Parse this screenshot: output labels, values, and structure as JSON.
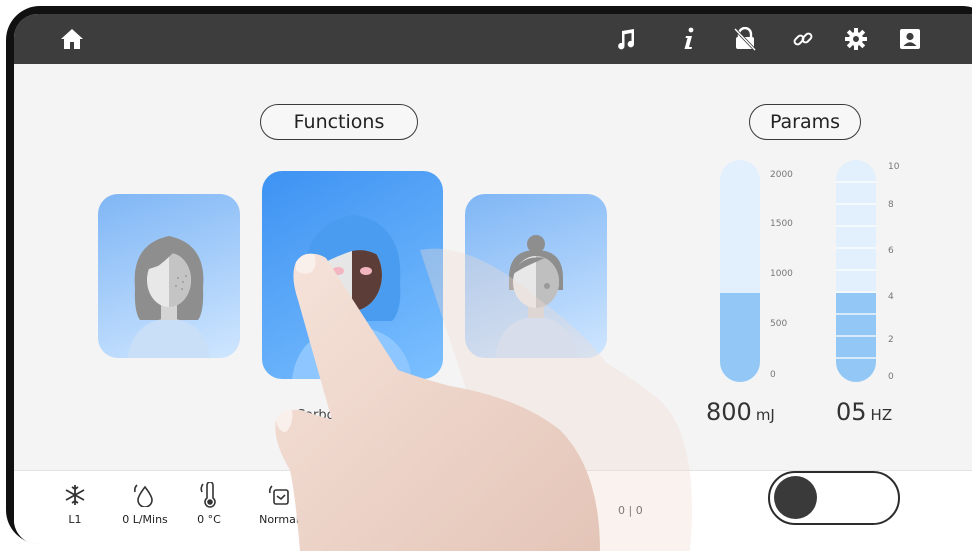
{
  "topbar": {
    "icons": [
      "home-icon",
      "music-note-icon",
      "info-icon",
      "lock-unlocked-icon",
      "link-icon",
      "gear-icon",
      "user-account-icon"
    ]
  },
  "functions": {
    "title": "Functions",
    "cards": [
      {
        "name": "whitening-face"
      },
      {
        "name": "carbon-peel-face"
      },
      {
        "name": "pigment-face"
      }
    ],
    "selected_label": "Carbon"
  },
  "params": {
    "title": "Params",
    "energy": {
      "ticks": [
        "2000",
        "1500",
        "1000",
        "500",
        "0"
      ],
      "value": "800",
      "unit": "mJ",
      "fill_fraction": 0.4
    },
    "frequency": {
      "ticks": [
        "10",
        "8",
        "6",
        "4",
        "2",
        "0"
      ],
      "value": "05",
      "unit": "HZ",
      "fill_fraction": 0.4
    }
  },
  "status": [
    {
      "icon": "snowflake-icon",
      "text": "L1"
    },
    {
      "icon": "water-drop-icon",
      "text": "0 L/Mins"
    },
    {
      "icon": "thermometer-icon",
      "text": "0 °C"
    },
    {
      "icon": "tank-level-icon",
      "text": "Normal"
    }
  ],
  "counter": "0 | 0",
  "colors": {
    "topbar": "#3d3d3d",
    "accent": "#3d92f2",
    "gauge_fill": "#93c8f6",
    "gauge_track": "#e2effc"
  }
}
